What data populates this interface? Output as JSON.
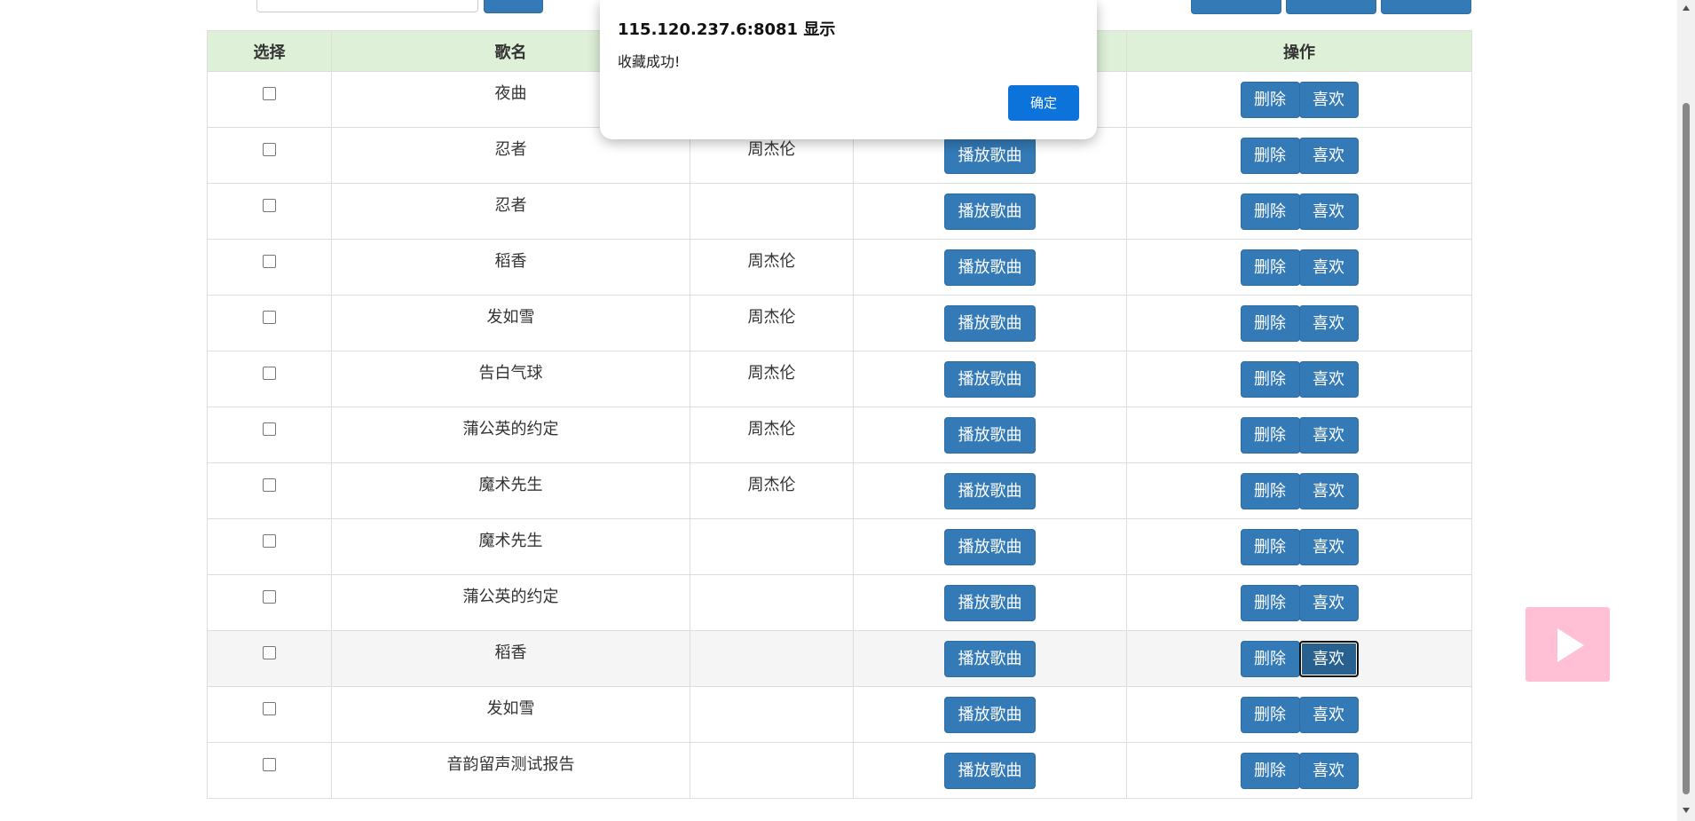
{
  "dialog": {
    "title": "115.120.237.6:8081 显示",
    "message": "收藏成功!",
    "ok_label": "确定"
  },
  "table": {
    "headers": {
      "select": "选择",
      "name": "歌名",
      "actions": "操作"
    },
    "rows": [
      {
        "name": "夜曲",
        "singer": ""
      },
      {
        "name": "忍者",
        "singer": "周杰伦"
      },
      {
        "name": "忍者",
        "singer": ""
      },
      {
        "name": "稻香",
        "singer": "周杰伦"
      },
      {
        "name": "发如雪",
        "singer": "周杰伦"
      },
      {
        "name": "告白气球",
        "singer": "周杰伦"
      },
      {
        "name": "蒲公英的约定",
        "singer": "周杰伦"
      },
      {
        "name": "魔术先生",
        "singer": "周杰伦"
      },
      {
        "name": "魔术先生",
        "singer": ""
      },
      {
        "name": "蒲公英的约定",
        "singer": ""
      },
      {
        "name": "稻香",
        "singer": ""
      },
      {
        "name": "发如雪",
        "singer": ""
      },
      {
        "name": "音韵留声测试报告",
        "singer": ""
      }
    ]
  },
  "buttons": {
    "play": "播放歌曲",
    "delete": "删除",
    "like": "喜欢"
  },
  "state": {
    "highlighted_row": 10,
    "focused_like_row": 10
  },
  "icons": {
    "floating_player": "play-icon"
  },
  "colors": {
    "primary_button": "#337ab7",
    "header_background": "#dff0d8",
    "dialog_ok": "#0b73d9",
    "floating_player": "#ffc0d6"
  }
}
